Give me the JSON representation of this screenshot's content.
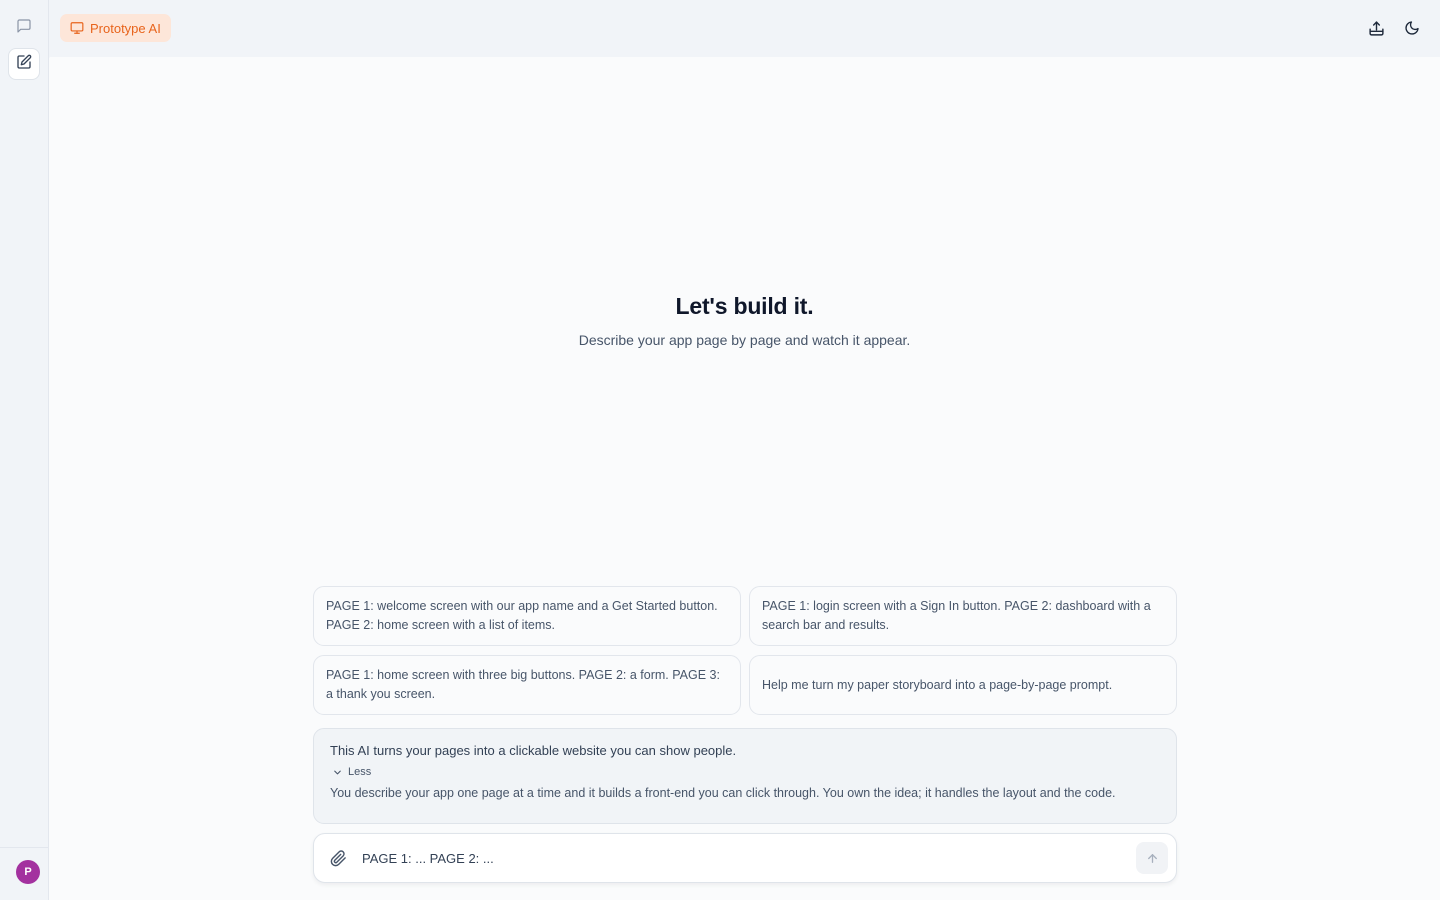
{
  "app": {
    "badge_label": "Prototype AI",
    "accent": "#e8641c",
    "avatar_initial": "P",
    "avatar_color": "#a3319f"
  },
  "rail": {
    "icons": [
      "chat-icon",
      "edit-icon"
    ]
  },
  "topbar": {
    "icons": [
      "share-icon",
      "moon-icon"
    ]
  },
  "hero": {
    "title": "Let's build it.",
    "subtitle": "Describe your app page by page and watch it appear."
  },
  "suggestions": [
    {
      "text": "PAGE 1: welcome screen with our app name and a Get Started button. PAGE 2: home screen with a list of items."
    },
    {
      "text": "PAGE 1: login screen with a Sign In button. PAGE 2: dashboard with a search bar and results."
    },
    {
      "text": "PAGE 1: home screen with three big buttons. PAGE 2: a form. PAGE 3: a thank you screen."
    },
    {
      "text": "Help me turn my paper storyboard into a page-by-page prompt."
    }
  ],
  "info": {
    "headline": "This AI turns your pages into a clickable website you can show people.",
    "toggle_label": "Less",
    "detail": "You describe your app one page at a time and it builds a front-end you can click through. You own the idea; it handles the layout and the code."
  },
  "composer": {
    "placeholder": "PAGE 1: ... PAGE 2: ..."
  }
}
